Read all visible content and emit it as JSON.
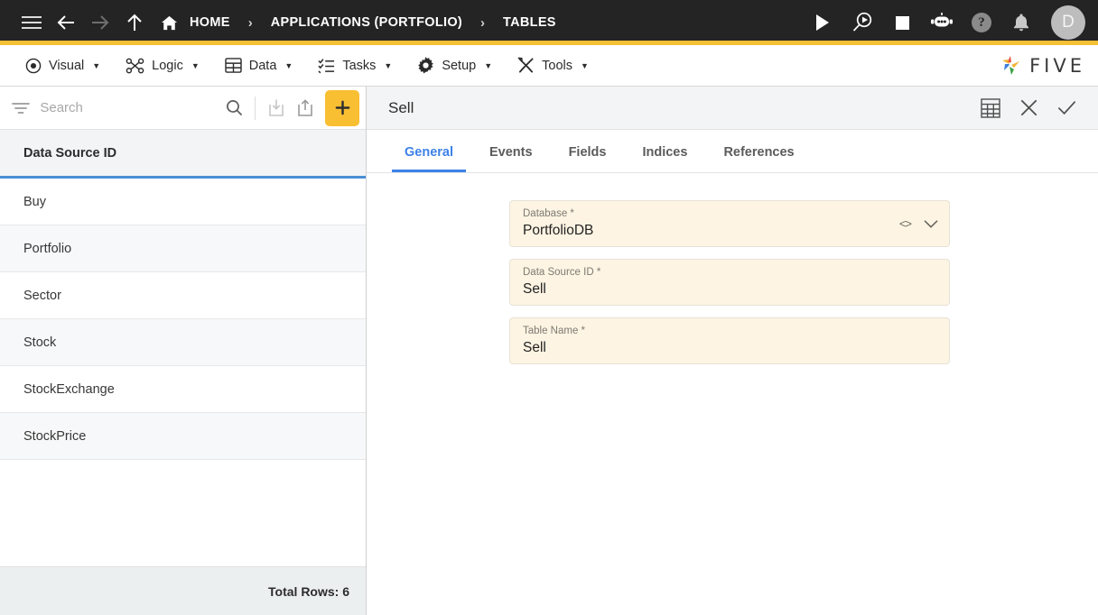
{
  "topbar": {
    "nav_icons": [
      "hamburger-icon",
      "back-arrow-icon",
      "forward-arrow-icon",
      "up-arrow-icon"
    ],
    "breadcrumb": [
      {
        "label": "HOME",
        "icon": "home-icon"
      },
      {
        "label": "APPLICATIONS (PORTFOLIO)",
        "icon": ""
      },
      {
        "label": "TABLES",
        "icon": ""
      }
    ],
    "separator": "›",
    "actions": [
      "run-icon",
      "debug-icon",
      "stop-icon",
      "chatbot-icon",
      "help-icon",
      "notifications-icon"
    ],
    "help_glyph": "?",
    "avatar_initial": "D",
    "accent_color": "#f5c033",
    "background": "#242424"
  },
  "menubar": {
    "items": [
      {
        "label": "Visual",
        "icon": "eye-icon"
      },
      {
        "label": "Logic",
        "icon": "logic-nodes-icon"
      },
      {
        "label": "Data",
        "icon": "table-grid-icon"
      },
      {
        "label": "Tasks",
        "icon": "checklist-icon"
      },
      {
        "label": "Setup",
        "icon": "gear-icon"
      },
      {
        "label": "Tools",
        "icon": "tools-icon"
      }
    ],
    "caret": "▼",
    "brand": "FIVE"
  },
  "sidebar": {
    "search": {
      "placeholder": "Search",
      "filter_icon": "filter-icon",
      "search_icon": "search-icon",
      "import_icon": "import-icon",
      "export_icon": "export-icon",
      "add_label": "+",
      "add_color": "#f9bf32"
    },
    "column_header": "Data Source ID",
    "rows": [
      {
        "label": "Buy"
      },
      {
        "label": "Portfolio"
      },
      {
        "label": "Sector"
      },
      {
        "label": "Stock"
      },
      {
        "label": "StockExchange"
      },
      {
        "label": "StockPrice"
      }
    ],
    "footer": "Total Rows: 6",
    "header_underline_color": "#4a8fd4"
  },
  "detail": {
    "title": "Sell",
    "header_icons": [
      "table-view-icon",
      "close-icon",
      "save-check-icon"
    ],
    "tabs": [
      {
        "label": "General",
        "active": true
      },
      {
        "label": "Events",
        "active": false
      },
      {
        "label": "Fields",
        "active": false
      },
      {
        "label": "Indices",
        "active": false
      },
      {
        "label": "References",
        "active": false
      }
    ],
    "active_tab_color": "#3c82e8",
    "fields": [
      {
        "label": "Database *",
        "value": "PortfolioDB",
        "has_code_icon": true,
        "has_dropdown": true,
        "code_glyph": "<>",
        "chevron": "chevron-down-icon"
      },
      {
        "label": "Data Source ID *",
        "value": "Sell",
        "has_code_icon": false,
        "has_dropdown": false
      },
      {
        "label": "Table Name *",
        "value": "Sell",
        "has_code_icon": false,
        "has_dropdown": false
      }
    ],
    "field_background": "#fdf4e3"
  }
}
